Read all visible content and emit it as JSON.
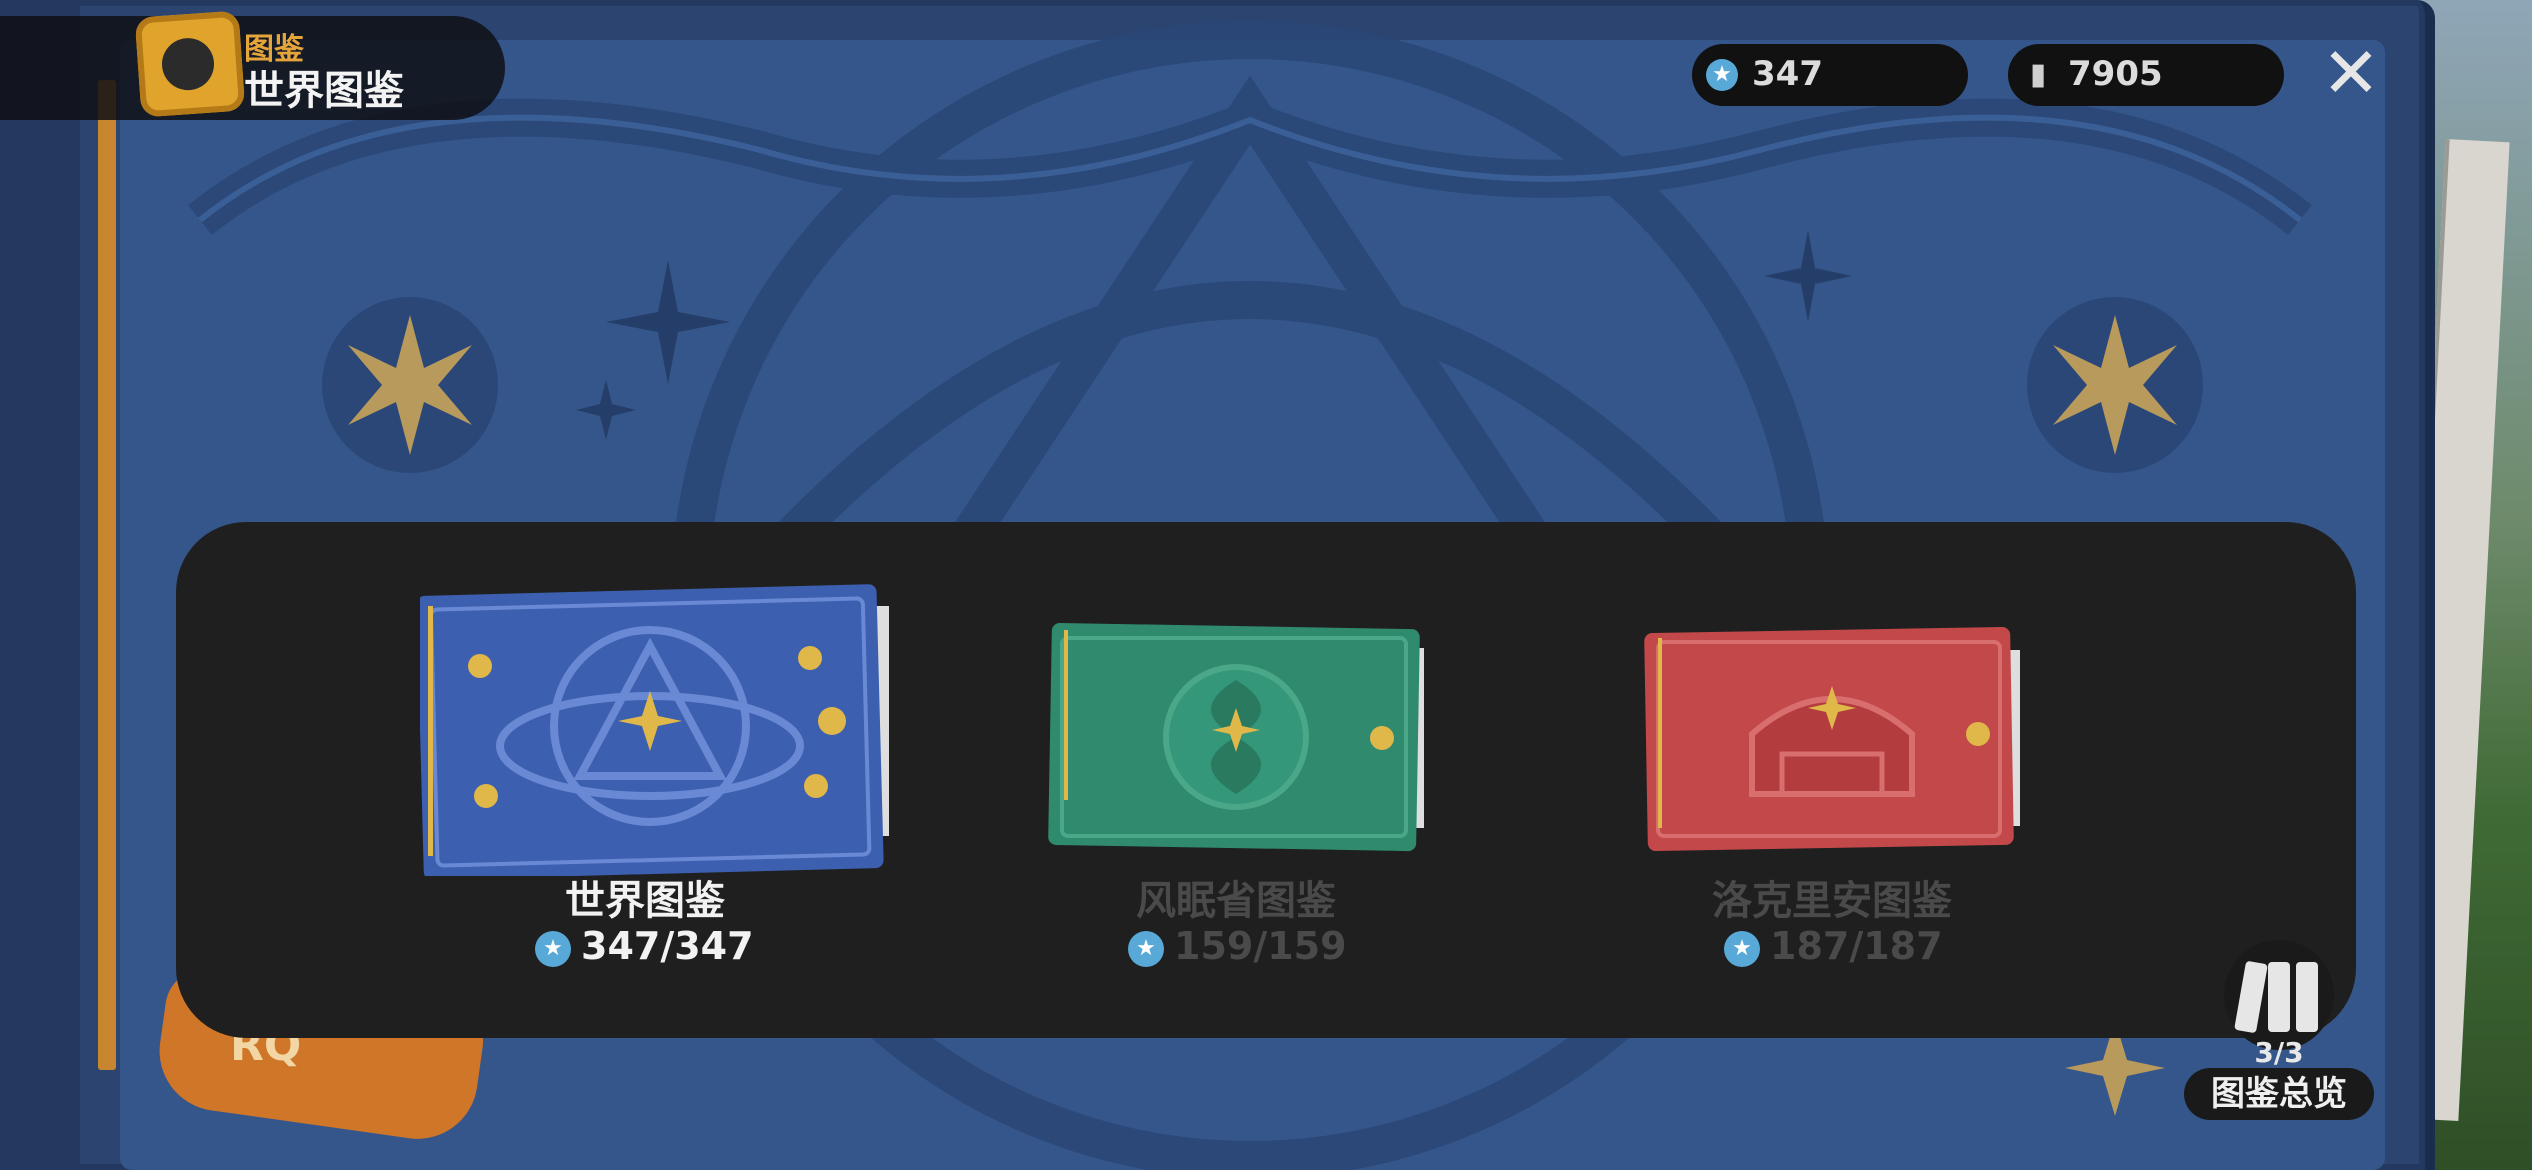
{
  "header": {
    "category_label": "图鉴",
    "title": "世界图鉴"
  },
  "currency": [
    {
      "icon": "star-coin-icon",
      "value": "347"
    },
    {
      "icon": "spray-can-icon",
      "value": "7905"
    }
  ],
  "albums": [
    {
      "name": "世界图鉴",
      "progress": "347/347",
      "cover_color": "#3d5fb0",
      "active": true
    },
    {
      "name": "风眠省图鉴",
      "progress": "159/159",
      "cover_color": "#2f8a6e",
      "active": false
    },
    {
      "name": "洛克里安图鉴",
      "progress": "187/187",
      "cover_color": "#c2484a",
      "active": false
    }
  ],
  "overview": {
    "count": "3/3",
    "label": "图鉴总览"
  },
  "badge_text": "RQ",
  "colors": {
    "accent_gold": "#e0a32c",
    "star_blue": "#58a9d8",
    "active_text": "#f2f2f2",
    "inactive_text": "#4a4a4a"
  }
}
